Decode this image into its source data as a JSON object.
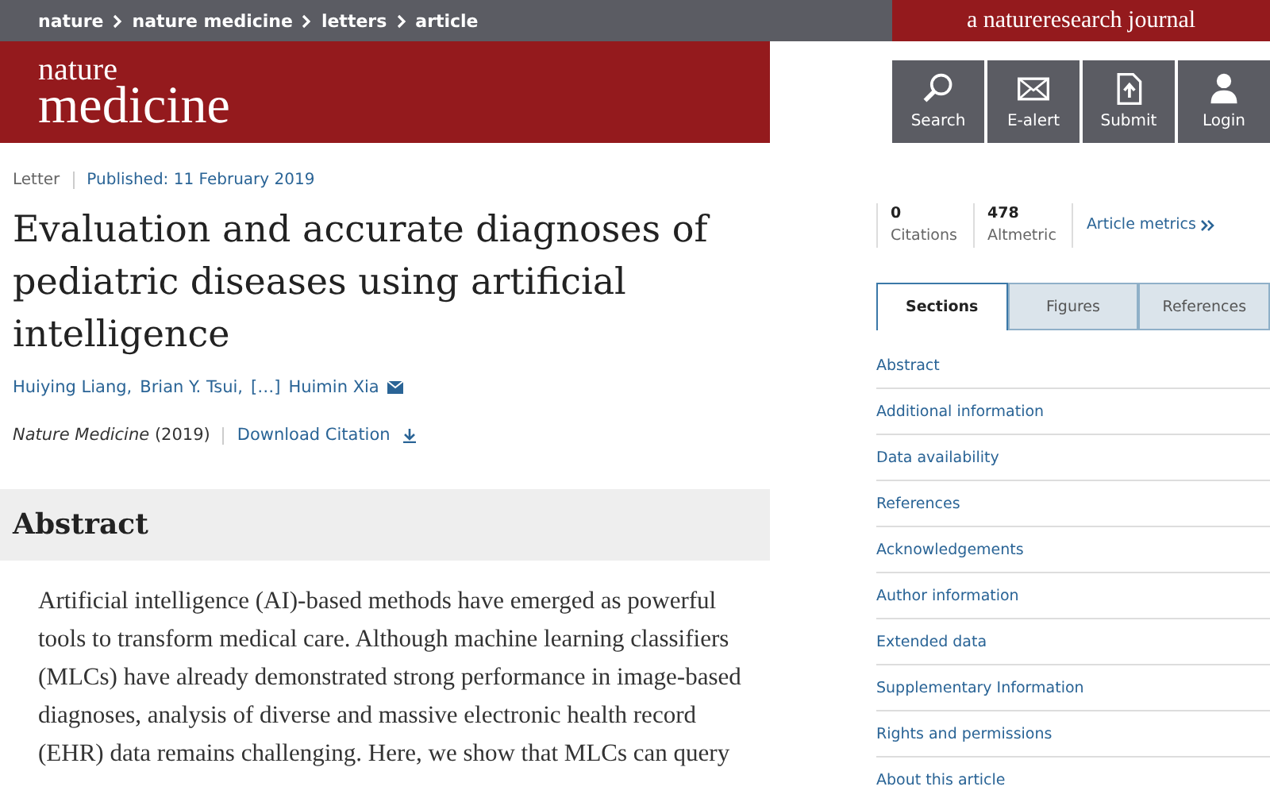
{
  "breadcrumbs": [
    "nature",
    "nature medicine",
    "letters",
    "article"
  ],
  "journal_tagline": "a natureresearch journal",
  "logo": {
    "line_1": "nature",
    "line_2": "medicine"
  },
  "header_buttons": [
    {
      "kind": "search",
      "label": "Search"
    },
    {
      "kind": "email",
      "label": "E-alert"
    },
    {
      "kind": "upload",
      "label": "Submit"
    },
    {
      "kind": "user",
      "label": "Login"
    }
  ],
  "article": {
    "type": "Letter",
    "published": "Published: 11 February 2019",
    "title": "Evaluation and accurate diagnoses of pediatric diseases using artificial intelligence",
    "authors": [
      "Huiying Liang,",
      "Brian Y. Tsui,",
      "[…]",
      "Huimin Xia"
    ],
    "journal": "Nature Medicine",
    "year": "(2019)",
    "download": "Download Citation"
  },
  "abstract": {
    "heading": "Abstract",
    "text": "Artificial intelligence (AI)-based methods have emerged as powerful tools to transform medical care. Although machine learning classifiers (MLCs) have already demonstrated strong performance in image-based diagnoses, analysis of diverse and massive electronic health record (EHR) data remains challenging. Here, we show that MLCs can query"
  },
  "metrics": [
    {
      "value": "0",
      "label": "Citations"
    },
    {
      "value": "478",
      "label": "Altmetric"
    }
  ],
  "metrics_link": "Article metrics",
  "tabs": [
    {
      "label": "Sections",
      "selected": true
    },
    {
      "label": "Figures",
      "selected": false
    },
    {
      "label": "References",
      "selected": false
    }
  ],
  "sections": [
    "Abstract",
    "Additional information",
    "Data availability",
    "References",
    "Acknowledgements",
    "Author information",
    "Extended data",
    "Supplementary Information",
    "Rights and permissions",
    "About this article"
  ]
}
